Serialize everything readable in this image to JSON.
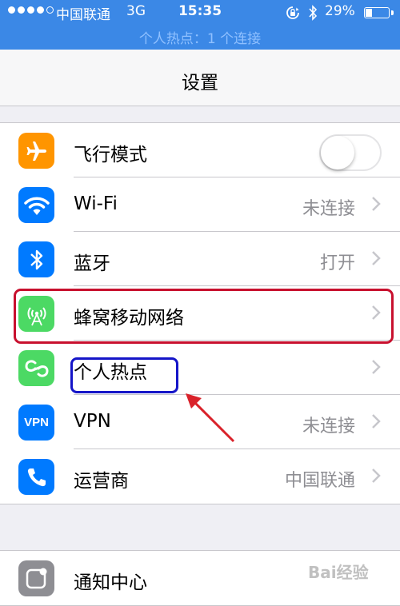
{
  "status_bar": {
    "carrier": "中国联通",
    "network": "3G",
    "time": "15:35",
    "battery_text": "29%",
    "battery_level": 0.29,
    "signal_strength": 4,
    "signal_max": 5,
    "hotspot_text": "个人热点：1 个连接",
    "icons": [
      "rotation-lock-icon",
      "bluetooth-icon",
      "battery-icon"
    ]
  },
  "nav": {
    "title": "设置"
  },
  "group1": {
    "rows": [
      {
        "label": "飞行模式",
        "toggle_on": false,
        "icon": "airplane-icon",
        "color": "#ff9500"
      },
      {
        "label": "Wi-Fi",
        "value": "未连接",
        "icon": "wifi-icon",
        "color": "#007aff"
      },
      {
        "label": "蓝牙",
        "value": "打开",
        "icon": "bluetooth-icon",
        "color": "#007aff"
      },
      {
        "label": "蜂窝移动网络",
        "value": "",
        "icon": "cellular-icon",
        "color": "#4cd964"
      },
      {
        "label": "个人热点",
        "value": "",
        "icon": "hotspot-icon",
        "color": "#4cd964"
      },
      {
        "label": "VPN",
        "value": "未连接",
        "icon": "vpn-icon",
        "icon_text": "VPN",
        "color": "#007aff"
      },
      {
        "label": "运营商",
        "value": "中国联通",
        "icon": "phone-icon",
        "color": "#007aff"
      }
    ]
  },
  "group2": {
    "rows": [
      {
        "label": "通知中心",
        "icon": "notification-center-icon",
        "color": "#8e8e93"
      }
    ]
  },
  "annotation": {
    "highlight_color_red": "#c8102e",
    "highlight_color_blue": "#1515c8",
    "arrow_color": "#d9222a"
  },
  "watermark": "Bai经验"
}
